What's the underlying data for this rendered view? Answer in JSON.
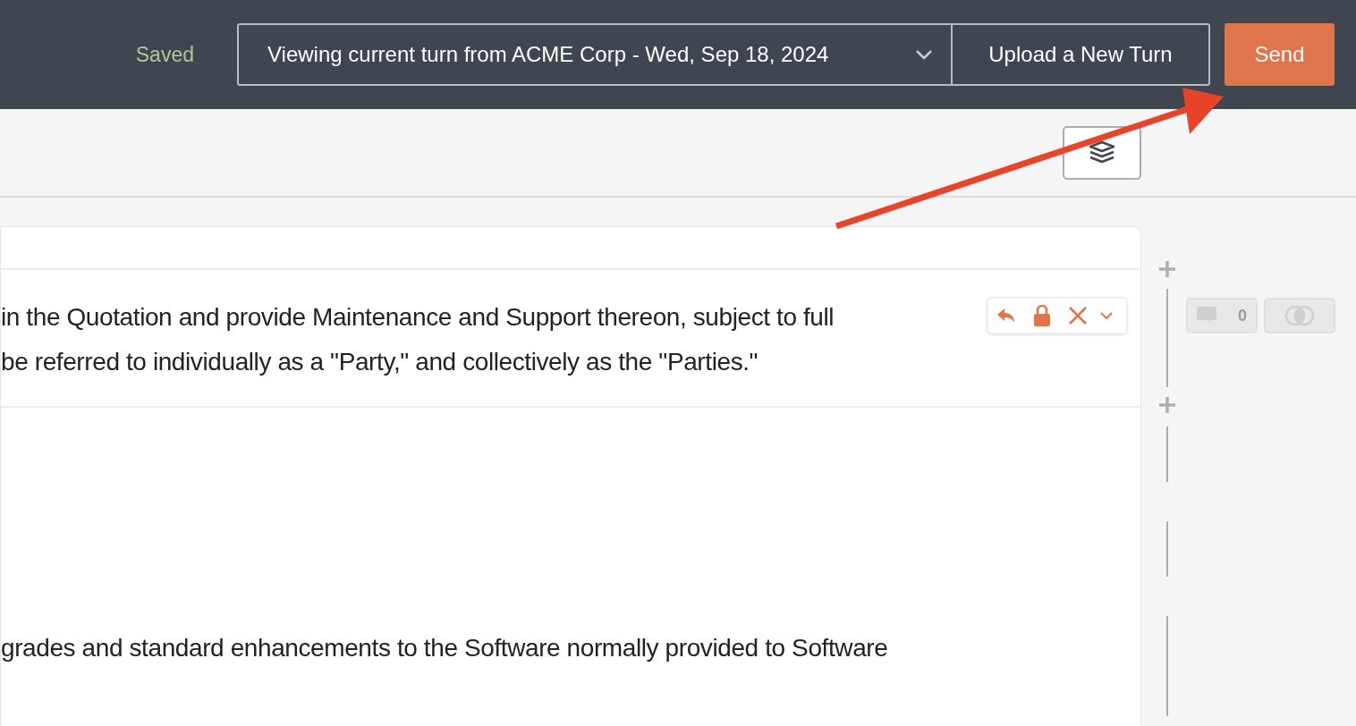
{
  "header": {
    "status": "Saved",
    "turn_select": {
      "value": "Viewing current turn from ACME Corp - Wed, Sep 18, 2024"
    },
    "upload_button": "Upload a New Turn",
    "send_button": "Send"
  },
  "document": {
    "paragraphs": [
      {
        "lines": [
          "in the Quotation and provide Maintenance and Support thereon, subject to full",
          "be referred to individually as a \"Party,\" and collectively as the \"Parties.\""
        ],
        "toolbar": true
      },
      {
        "lines": [
          "grades and standard enhancements to the Software normally provided to Software"
        ],
        "toolbar": false
      }
    ]
  },
  "gutter": {
    "comment_count": "0"
  },
  "annotation": {
    "kind": "arrow"
  }
}
